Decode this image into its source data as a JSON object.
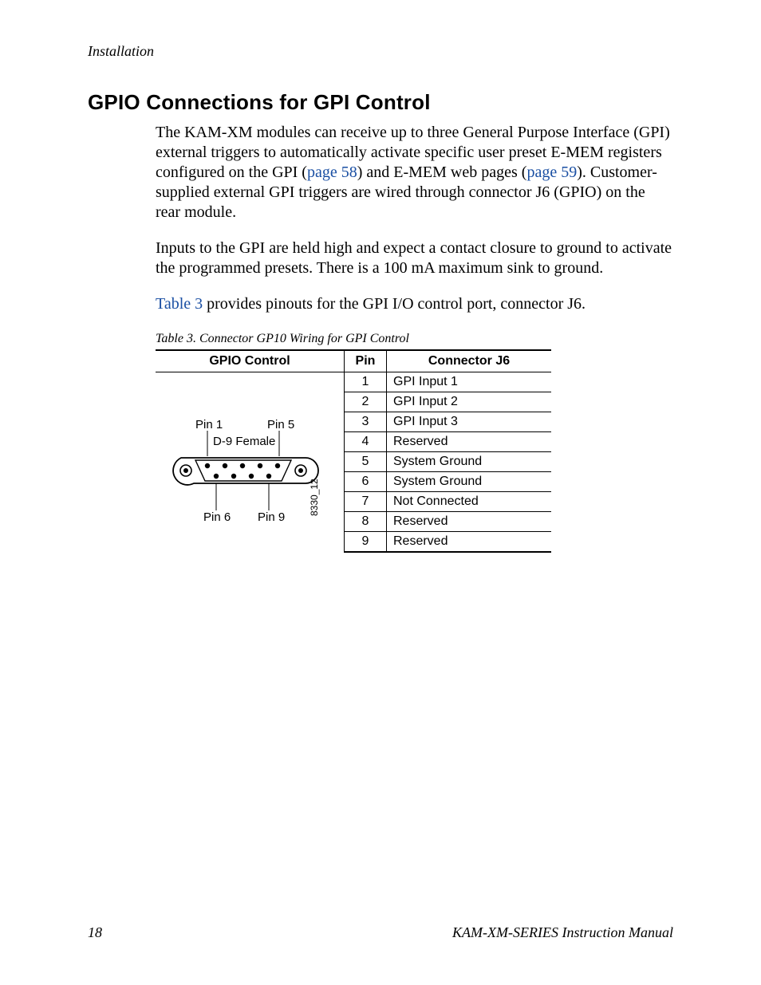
{
  "header": {
    "running": "Installation"
  },
  "section": {
    "title": "GPIO Connections for GPI Control"
  },
  "paras": {
    "p1a": "The KAM-XM modules can receive up to three General Purpose Interface (GPI) external triggers to automatically activate specific user preset E-MEM registers configured on the GPI (",
    "p1link1": "page 58",
    "p1b": ") and E-MEM web pages (",
    "p1link2": "page 59",
    "p1c": "). Customer-supplied external GPI triggers are wired through connector J6 (GPIO) on the rear module.",
    "p2": "Inputs to the GPI are held high and expect a contact closure to ground to activate the programmed presets. There is a 100 mA maximum sink to ground.",
    "p3link": "Table 3",
    "p3rest": " provides pinouts for the GPI I/O control port, connector J6."
  },
  "table": {
    "caption": "Table 3.  Connector GP10 Wiring for GPI Control",
    "headers": {
      "c1": "GPIO Control",
      "c2": "Pin",
      "c3": "Connector J6"
    },
    "rows": [
      {
        "pin": "1",
        "desc": "GPI Input 1"
      },
      {
        "pin": "2",
        "desc": "GPI Input 2"
      },
      {
        "pin": "3",
        "desc": "GPI Input 3"
      },
      {
        "pin": "4",
        "desc": "Reserved"
      },
      {
        "pin": "5",
        "desc": "System Ground"
      },
      {
        "pin": "6",
        "desc": "System Ground"
      },
      {
        "pin": "7",
        "desc": "Not Connected"
      },
      {
        "pin": "8",
        "desc": "Reserved"
      },
      {
        "pin": "9",
        "desc": "Reserved"
      }
    ]
  },
  "diagram": {
    "pin1": "Pin 1",
    "pin5": "Pin 5",
    "d9": "D-9 Female",
    "pin6": "Pin 6",
    "pin9": "Pin 9",
    "code": "8330_12"
  },
  "footer": {
    "page": "18",
    "title": "KAM-XM-SERIES Instruction Manual"
  }
}
